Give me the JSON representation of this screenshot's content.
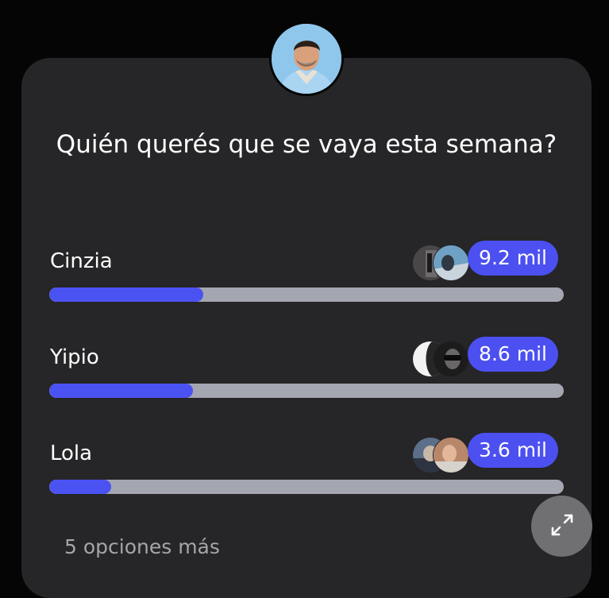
{
  "poll": {
    "question": "Quién querés que se vaya esta semana?",
    "host_avatar": "host-avatar",
    "options": [
      {
        "label": "Cinzia",
        "count": "9.2 mil",
        "progress": 0.3
      },
      {
        "label": "Yipio",
        "count": "8.6 mil",
        "progress": 0.28
      },
      {
        "label": "Lola",
        "count": "3.6 mil",
        "progress": 0.12
      }
    ],
    "more_options": "5 opciones más",
    "expand_icon": "expand-icon"
  },
  "colors": {
    "accent": "#4b52f2",
    "card": "#262527",
    "track": "#a4a7b1"
  }
}
